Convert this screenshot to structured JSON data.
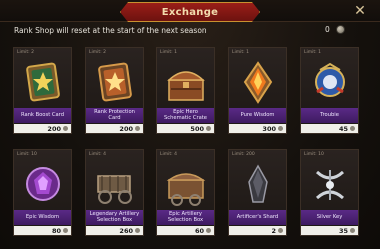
{
  "header": {
    "title": "Exchange",
    "close_icon": "close-icon"
  },
  "notice": "Rank Shop will reset at the start of the next season",
  "currency": {
    "amount": "0",
    "icon": "coin-icon"
  },
  "items": [
    {
      "limit": "Limit: 2",
      "name": "Rank Boost Card",
      "price": "200",
      "icon": "green-star-shield-icon"
    },
    {
      "limit": "Limit: 2",
      "name": "Rank Protection Card",
      "price": "200",
      "icon": "orange-star-shield-icon"
    },
    {
      "limit": "Limit: 1",
      "name": "Epic Hero Schematic Crate",
      "price": "500",
      "icon": "treasure-chest-icon"
    },
    {
      "limit": "Limit: 1",
      "name": "Pure Wisdom",
      "price": "300",
      "icon": "fire-crystal-icon"
    },
    {
      "limit": "Limit: 1",
      "name": "Troubie",
      "price": "45",
      "icon": "troubie-badge-icon"
    },
    {
      "limit": "Limit: 10",
      "name": "Epic Wisdom",
      "price": "80",
      "icon": "purple-gem-icon"
    },
    {
      "limit": "Limit: 4",
      "name": "Legendary Artillery Selection Box",
      "price": "260",
      "icon": "artillery-cart-icon"
    },
    {
      "limit": "Limit: 4",
      "name": "Epic Artillery Selection Box",
      "price": "60",
      "icon": "artillery-chest-icon"
    },
    {
      "limit": "Limit: 200",
      "name": "Artificer's Shard",
      "price": "2",
      "icon": "dark-shard-icon"
    },
    {
      "limit": "Limit: 10",
      "name": "Silver Key",
      "price": "35",
      "icon": "silver-key-icon"
    }
  ]
}
